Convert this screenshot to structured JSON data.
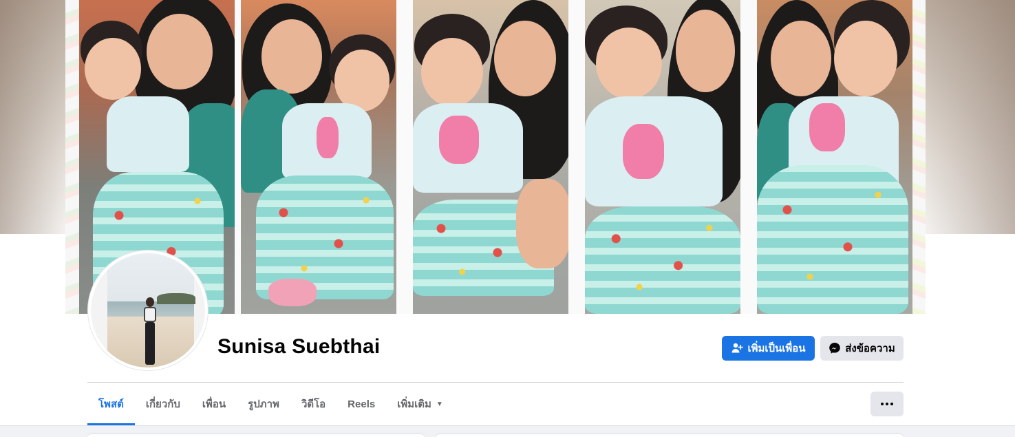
{
  "profile": {
    "name": "Sunisa Suebthai"
  },
  "actions": {
    "add_friend_label": "เพิ่มเป็นเพื่อน",
    "message_label": "ส่งข้อความ"
  },
  "tabs": [
    {
      "label": "โพสต์",
      "active": true
    },
    {
      "label": "เกี่ยวกับ"
    },
    {
      "label": "เพื่อน"
    },
    {
      "label": "รูปภาพ"
    },
    {
      "label": "วิดีโอ"
    },
    {
      "label": "Reels"
    },
    {
      "label": "เพิ่มเติม",
      "caret": "▼"
    }
  ],
  "colors": {
    "accent": "#1b74e4",
    "secondary_button": "#e4e6eb",
    "text_primary": "#050505",
    "text_secondary": "#65676b"
  },
  "icons": {
    "add_friend": "add-person-icon",
    "message": "messenger-icon",
    "more": "more-dots-icon",
    "dropdown": "caret-down-icon"
  }
}
